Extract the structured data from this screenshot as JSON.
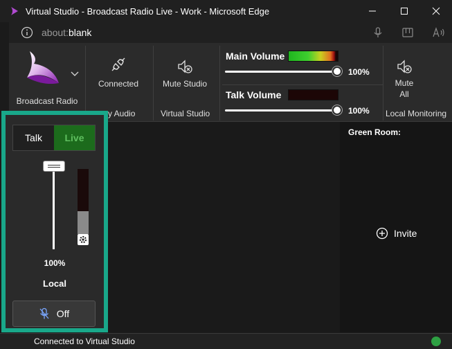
{
  "window": {
    "title": "Virtual Studio - Broadcast Radio Live - Work - Microsoft Edge"
  },
  "address": {
    "prefix": "about:",
    "value": "blank"
  },
  "ribbon": {
    "app_name": "Broadcast Radio",
    "connected_label": "Connected",
    "group_studio_audio": "y Audio",
    "mute_studio_label": "Mute Studio",
    "group_virtual_studio": "Virtual Studio",
    "main_volume_label": "Main Volume",
    "main_volume_pct": "100%",
    "talk_volume_label": "Talk Volume",
    "talk_volume_pct": "100%",
    "mute_all_line1": "Mute",
    "mute_all_line2": "All",
    "group_local_monitoring": "Local Monitoring",
    "main_volume_level": 1.0,
    "talk_volume_level": 1.0
  },
  "green_room": {
    "title": "Green Room:",
    "invite_label": "Invite"
  },
  "local": {
    "talk_label": "Talk",
    "live_label": "Live",
    "fader_pct": "100%",
    "fader_level": 1.0,
    "name": "Local",
    "mic_button_label": "Off",
    "meter_level": 0.35
  },
  "status": {
    "text": "Connected to Virtual Studio"
  },
  "colors": {
    "accent_highlight": "#19a88a",
    "live_green": "#1c6b1c",
    "status_ok": "#2ea043"
  }
}
